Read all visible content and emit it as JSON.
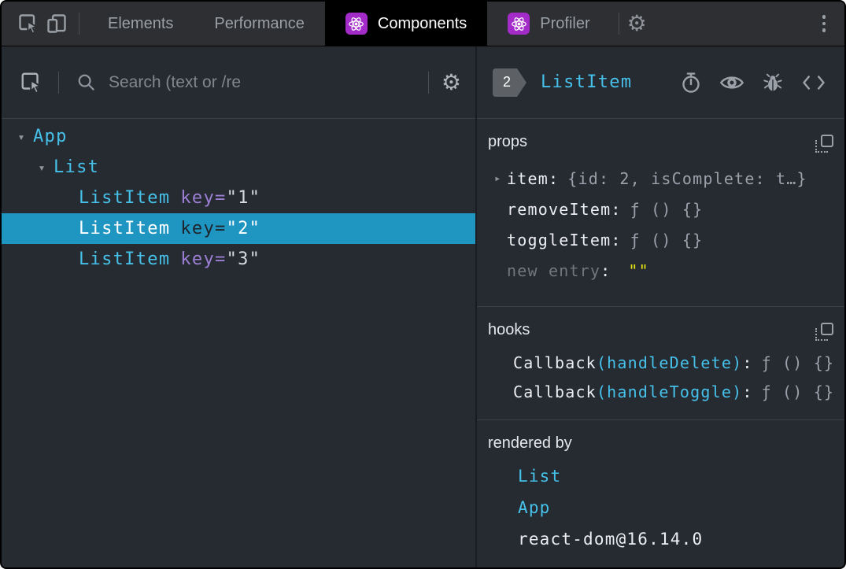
{
  "colors": {
    "accent_cyan": "#46c1ea",
    "selected_row_blue": "#1e96c1",
    "attribute_purple": "#9d7fd6",
    "editable_yellow": "#e3e312",
    "react_badge_purple": "#a32cc8",
    "panel_background": "#262b32"
  },
  "icons": {
    "gear": "⚙"
  },
  "tabbar": {
    "tabs": [
      {
        "label": "Elements"
      },
      {
        "label": "Performance"
      },
      {
        "label": "Components"
      },
      {
        "label": "Profiler"
      }
    ]
  },
  "left": {
    "search_placeholder": "Search (text or /re",
    "tree": [
      {
        "expander": "▾",
        "name": "App"
      },
      {
        "expander": "▾",
        "name": "List"
      },
      {
        "expander": "",
        "name": "ListItem",
        "attr_name": "key",
        "attr_eq": "=",
        "attr_value": "\"1\""
      },
      {
        "expander": "",
        "name": "ListItem",
        "attr_name": "key",
        "attr_eq": "=",
        "attr_value": "\"2\""
      },
      {
        "expander": "",
        "name": "ListItem",
        "attr_name": "key",
        "attr_eq": "=",
        "attr_value": "\"3\""
      }
    ]
  },
  "right": {
    "badge_count": "2",
    "title": "ListItem",
    "props": {
      "header": "props",
      "rows": [
        {
          "expander": "▸",
          "name": "item",
          "colon": ":",
          "value": "{id: 2, isComplete: t…}"
        },
        {
          "expander": "",
          "name": "removeItem",
          "colon": ":",
          "value": "ƒ () {}"
        },
        {
          "expander": "",
          "name": "toggleItem",
          "colon": ":",
          "value": "ƒ () {}"
        }
      ],
      "new_entry": {
        "name": "new entry",
        "colon": ":",
        "value": "\"\""
      }
    },
    "hooks": {
      "header": "hooks",
      "rows": [
        {
          "fn": "Callback",
          "arg": "(handleDelete)",
          "colon": ":",
          "value": "ƒ () {}"
        },
        {
          "fn": "Callback",
          "arg": "(handleToggle)",
          "colon": ":",
          "value": "ƒ () {}"
        }
      ]
    },
    "rendered_by": {
      "header": "rendered by",
      "items": [
        {
          "label": "List"
        },
        {
          "label": "App"
        },
        {
          "label": "react-dom@16.14.0"
        }
      ]
    }
  }
}
